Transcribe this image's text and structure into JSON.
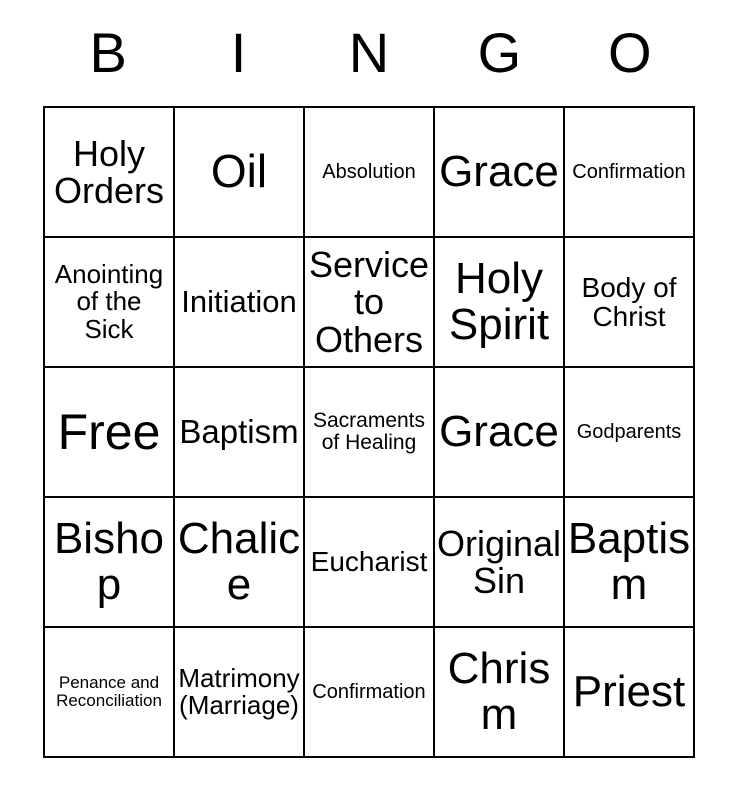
{
  "header": {
    "letters": [
      "B",
      "I",
      "N",
      "G",
      "O"
    ]
  },
  "grid": {
    "columns": 5,
    "rows": 5,
    "border_color": "#000000",
    "background_color": "#ffffff",
    "text_color": "#000000",
    "cells": [
      {
        "text": "Holy\nOrders",
        "size": "s-xl"
      },
      {
        "text": "Oil",
        "size": "s-hg"
      },
      {
        "text": "Absolution",
        "size": "s-sm"
      },
      {
        "text": "Grace",
        "size": "s-xxl"
      },
      {
        "text": "Confirmation",
        "size": "s-sm"
      },
      {
        "text": "Anointing\nof the\nSick",
        "size": "s-md"
      },
      {
        "text": "Initiation",
        "size": "s-lg"
      },
      {
        "text": "Service\nto\nOthers",
        "size": "s-xl"
      },
      {
        "text": "Holy\nSpirit",
        "size": "s-xxl"
      },
      {
        "text": "Body of\nChrist",
        "size": "s-mdl"
      },
      {
        "text": "Free",
        "size": "s-max"
      },
      {
        "text": "Baptism",
        "size": "s-lgr"
      },
      {
        "text": "Sacraments\nof Healing",
        "size": "s-smd"
      },
      {
        "text": "Grace",
        "size": "s-xxl"
      },
      {
        "text": "Godparents",
        "size": "s-sm"
      },
      {
        "text": "Bishop",
        "size": "s-xxl"
      },
      {
        "text": "Chalice",
        "size": "s-xxl"
      },
      {
        "text": "Eucharist",
        "size": "s-mdl"
      },
      {
        "text": "Original\nSin",
        "size": "s-xl"
      },
      {
        "text": "Baptism",
        "size": "s-xxl"
      },
      {
        "text": "Penance and\nReconciliation",
        "size": "s-xs"
      },
      {
        "text": "Matrimony\n(Marriage)",
        "size": "s-md"
      },
      {
        "text": "Confirmation",
        "size": "s-sm"
      },
      {
        "text": "Chrism",
        "size": "s-xxl"
      },
      {
        "text": "Priest",
        "size": "s-xxl"
      }
    ]
  }
}
